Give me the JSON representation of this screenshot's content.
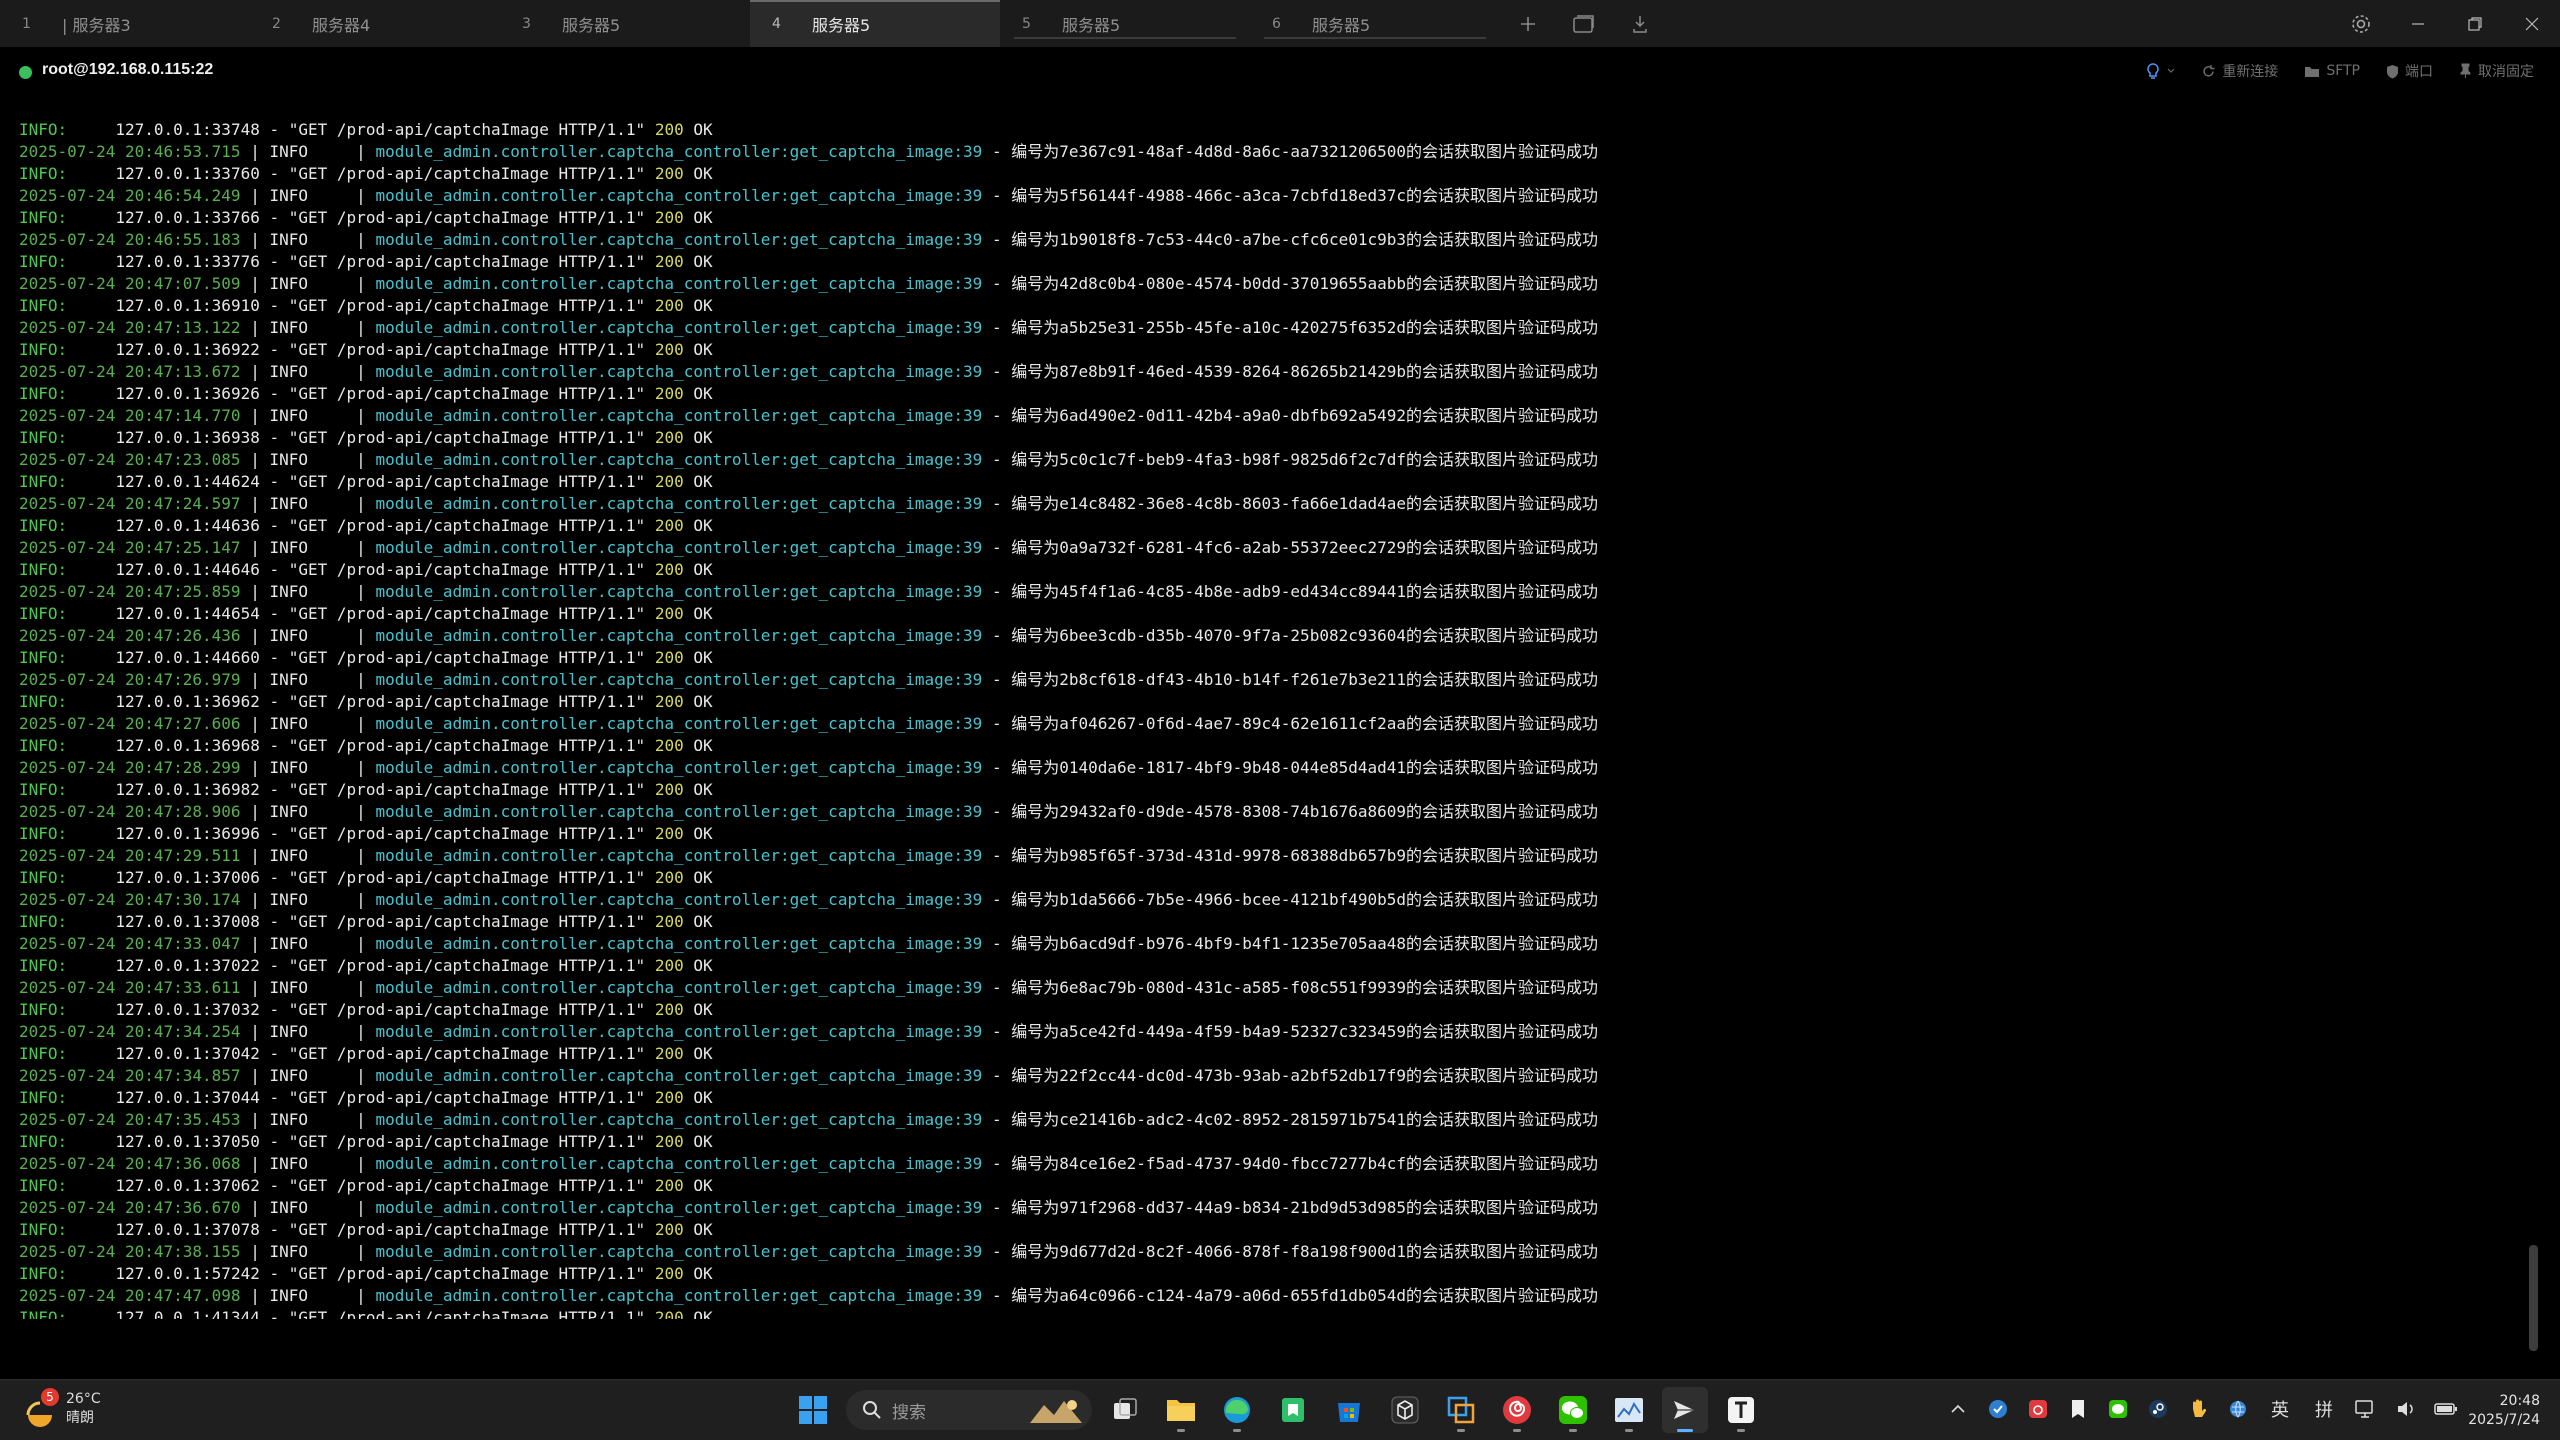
{
  "tabs": [
    {
      "num": "1",
      "label": "| 服务器3"
    },
    {
      "num": "2",
      "label": "服务器4"
    },
    {
      "num": "3",
      "label": "服务器5"
    },
    {
      "num": "4",
      "label": "服务器5"
    },
    {
      "num": "5",
      "label": "服务器5"
    },
    {
      "num": "6",
      "label": "服务器5"
    }
  ],
  "active_tab_index": 3,
  "status": {
    "connection": "root@192.168.0.115:22",
    "actions": {
      "reconnect": "重新连接",
      "sftp": "SFTP",
      "port": "端口",
      "unpin": "取消固定"
    }
  },
  "log": {
    "first_line": {
      "level": "INFO:",
      "client": "127.0.0.1:33748",
      "request": "\"GET /prod-api/captchaImage HTTP/1.1\"",
      "code": "200",
      "status": "OK"
    },
    "module": "module_admin.controller.captcha_controller:get_captcha_image:39",
    "level_word": "INFO",
    "msg_prefix": "编号为",
    "msg_suffix": "的会话获取图片验证码成功",
    "request": "\"GET /prod-api/captchaImage HTTP/1.1\"",
    "code": "200",
    "status": "OK",
    "access_level": "INFO:",
    "entries": [
      {
        "ts": "2025-07-24 20:46:53.715",
        "uuid": "7e367c91-48af-4d8d-8a6c-aa7321206500",
        "client": "127.0.0.1:33760"
      },
      {
        "ts": "2025-07-24 20:46:54.249",
        "uuid": "5f56144f-4988-466c-a3ca-7cbfd18ed37c",
        "client": "127.0.0.1:33766"
      },
      {
        "ts": "2025-07-24 20:46:55.183",
        "uuid": "1b9018f8-7c53-44c0-a7be-cfc6ce01c9b3",
        "client": "127.0.0.1:33776"
      },
      {
        "ts": "2025-07-24 20:47:07.509",
        "uuid": "42d8c0b4-080e-4574-b0dd-37019655aabb",
        "client": "127.0.0.1:36910"
      },
      {
        "ts": "2025-07-24 20:47:13.122",
        "uuid": "a5b25e31-255b-45fe-a10c-420275f6352d",
        "client": "127.0.0.1:36922"
      },
      {
        "ts": "2025-07-24 20:47:13.672",
        "uuid": "87e8b91f-46ed-4539-8264-86265b21429b",
        "client": "127.0.0.1:36926"
      },
      {
        "ts": "2025-07-24 20:47:14.770",
        "uuid": "6ad490e2-0d11-42b4-a9a0-dbfb692a5492",
        "client": "127.0.0.1:36938"
      },
      {
        "ts": "2025-07-24 20:47:23.085",
        "uuid": "5c0c1c7f-beb9-4fa3-b98f-9825d6f2c7df",
        "client": "127.0.0.1:44624"
      },
      {
        "ts": "2025-07-24 20:47:24.597",
        "uuid": "e14c8482-36e8-4c8b-8603-fa66e1dad4ae",
        "client": "127.0.0.1:44636"
      },
      {
        "ts": "2025-07-24 20:47:25.147",
        "uuid": "0a9a732f-6281-4fc6-a2ab-55372eec2729",
        "client": "127.0.0.1:44646"
      },
      {
        "ts": "2025-07-24 20:47:25.859",
        "uuid": "45f4f1a6-4c85-4b8e-adb9-ed434cc89441",
        "client": "127.0.0.1:44654"
      },
      {
        "ts": "2025-07-24 20:47:26.436",
        "uuid": "6bee3cdb-d35b-4070-9f7a-25b082c93604",
        "client": "127.0.0.1:44660"
      },
      {
        "ts": "2025-07-24 20:47:26.979",
        "uuid": "2b8cf618-df43-4b10-b14f-f261e7b3e211",
        "client": "127.0.0.1:36962"
      },
      {
        "ts": "2025-07-24 20:47:27.606",
        "uuid": "af046267-0f6d-4ae7-89c4-62e1611cf2aa",
        "client": "127.0.0.1:36968"
      },
      {
        "ts": "2025-07-24 20:47:28.299",
        "uuid": "0140da6e-1817-4bf9-9b48-044e85d4ad41",
        "client": "127.0.0.1:36982"
      },
      {
        "ts": "2025-07-24 20:47:28.906",
        "uuid": "29432af0-d9de-4578-8308-74b1676a8609",
        "client": "127.0.0.1:36996"
      },
      {
        "ts": "2025-07-24 20:47:29.511",
        "uuid": "b985f65f-373d-431d-9978-68388db657b9",
        "client": "127.0.0.1:37006"
      },
      {
        "ts": "2025-07-24 20:47:30.174",
        "uuid": "b1da5666-7b5e-4966-bcee-4121bf490b5d",
        "client": "127.0.0.1:37008"
      },
      {
        "ts": "2025-07-24 20:47:33.047",
        "uuid": "b6acd9df-b976-4bf9-b4f1-1235e705aa48",
        "client": "127.0.0.1:37022"
      },
      {
        "ts": "2025-07-24 20:47:33.611",
        "uuid": "6e8ac79b-080d-431c-a585-f08c551f9939",
        "client": "127.0.0.1:37032"
      },
      {
        "ts": "2025-07-24 20:47:34.254",
        "uuid": "a5ce42fd-449a-4f59-b4a9-52327c323459",
        "client": "127.0.0.1:37042"
      },
      {
        "ts": "2025-07-24 20:47:34.857",
        "uuid": "22f2cc44-dc0d-473b-93ab-a2bf52db17f9",
        "client": "127.0.0.1:37044"
      },
      {
        "ts": "2025-07-24 20:47:35.453",
        "uuid": "ce21416b-adc2-4c02-8952-2815971b7541",
        "client": "127.0.0.1:37050"
      },
      {
        "ts": "2025-07-24 20:47:36.068",
        "uuid": "84ce16e2-f5ad-4737-94d0-fbcc7277b4cf",
        "client": "127.0.0.1:37062"
      },
      {
        "ts": "2025-07-24 20:47:36.670",
        "uuid": "971f2968-dd37-44a9-b834-21bd9d53d985",
        "client": "127.0.0.1:37078"
      },
      {
        "ts": "2025-07-24 20:47:38.155",
        "uuid": "9d677d2d-8c2f-4066-878f-f8a198f900d1",
        "client": "127.0.0.1:57242"
      },
      {
        "ts": "2025-07-24 20:47:47.098",
        "uuid": "a64c0966-c124-4a79-a06d-655fd1db054d",
        "client": "127.0.0.1:41344"
      }
    ]
  },
  "taskbar": {
    "weather": {
      "temp": "26°C",
      "desc": "晴朗",
      "badge": "5"
    },
    "search_placeholder": "搜索",
    "ime_lang": "英",
    "ime_mode": "拼",
    "time": "20:48",
    "date": "2025/7/24"
  },
  "colors": {
    "accent": "#5fb2ff",
    "connected": "#3ac05c",
    "log_timestamp": "#58b04e",
    "log_module": "#45c4cf",
    "log_status_code": "#d8d85a"
  }
}
